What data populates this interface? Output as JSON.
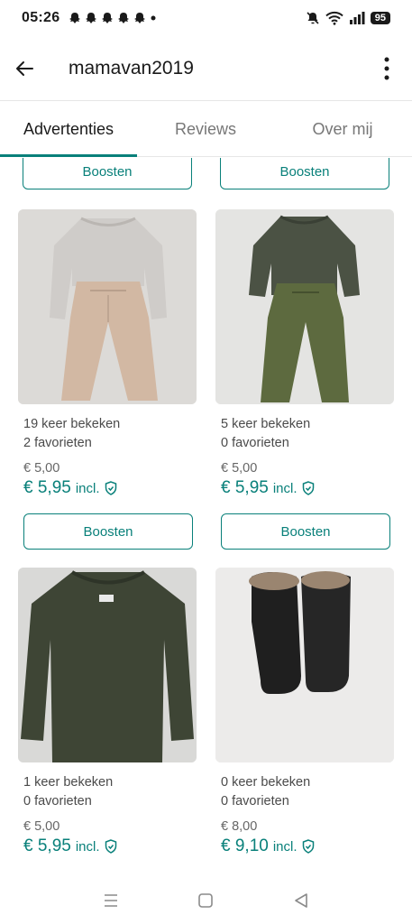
{
  "status": {
    "time": "05:26",
    "battery": "95"
  },
  "header": {
    "title": "mamavan2019"
  },
  "tabs": [
    {
      "label": "Advertenties",
      "active": true
    },
    {
      "label": "Reviews",
      "active": false
    },
    {
      "label": "Over mij",
      "active": false
    }
  ],
  "boost_label": "Boosten",
  "incl_label": "incl.",
  "items": [
    {
      "views": "19 keer bekeken",
      "favorites": "2 favorieten",
      "price": "€ 5,00",
      "price_incl": "€ 5,95"
    },
    {
      "views": "5 keer bekeken",
      "favorites": "0 favorieten",
      "price": "€ 5,00",
      "price_incl": "€ 5,95"
    },
    {
      "views": "1 keer bekeken",
      "favorites": "0 favorieten",
      "price": "€ 5,00",
      "price_incl": "€ 5,95"
    },
    {
      "views": "0 keer bekeken",
      "favorites": "0 favorieten",
      "price": "€ 8,00",
      "price_incl": "€ 9,10"
    }
  ],
  "colors": {
    "accent": "#09807a"
  }
}
